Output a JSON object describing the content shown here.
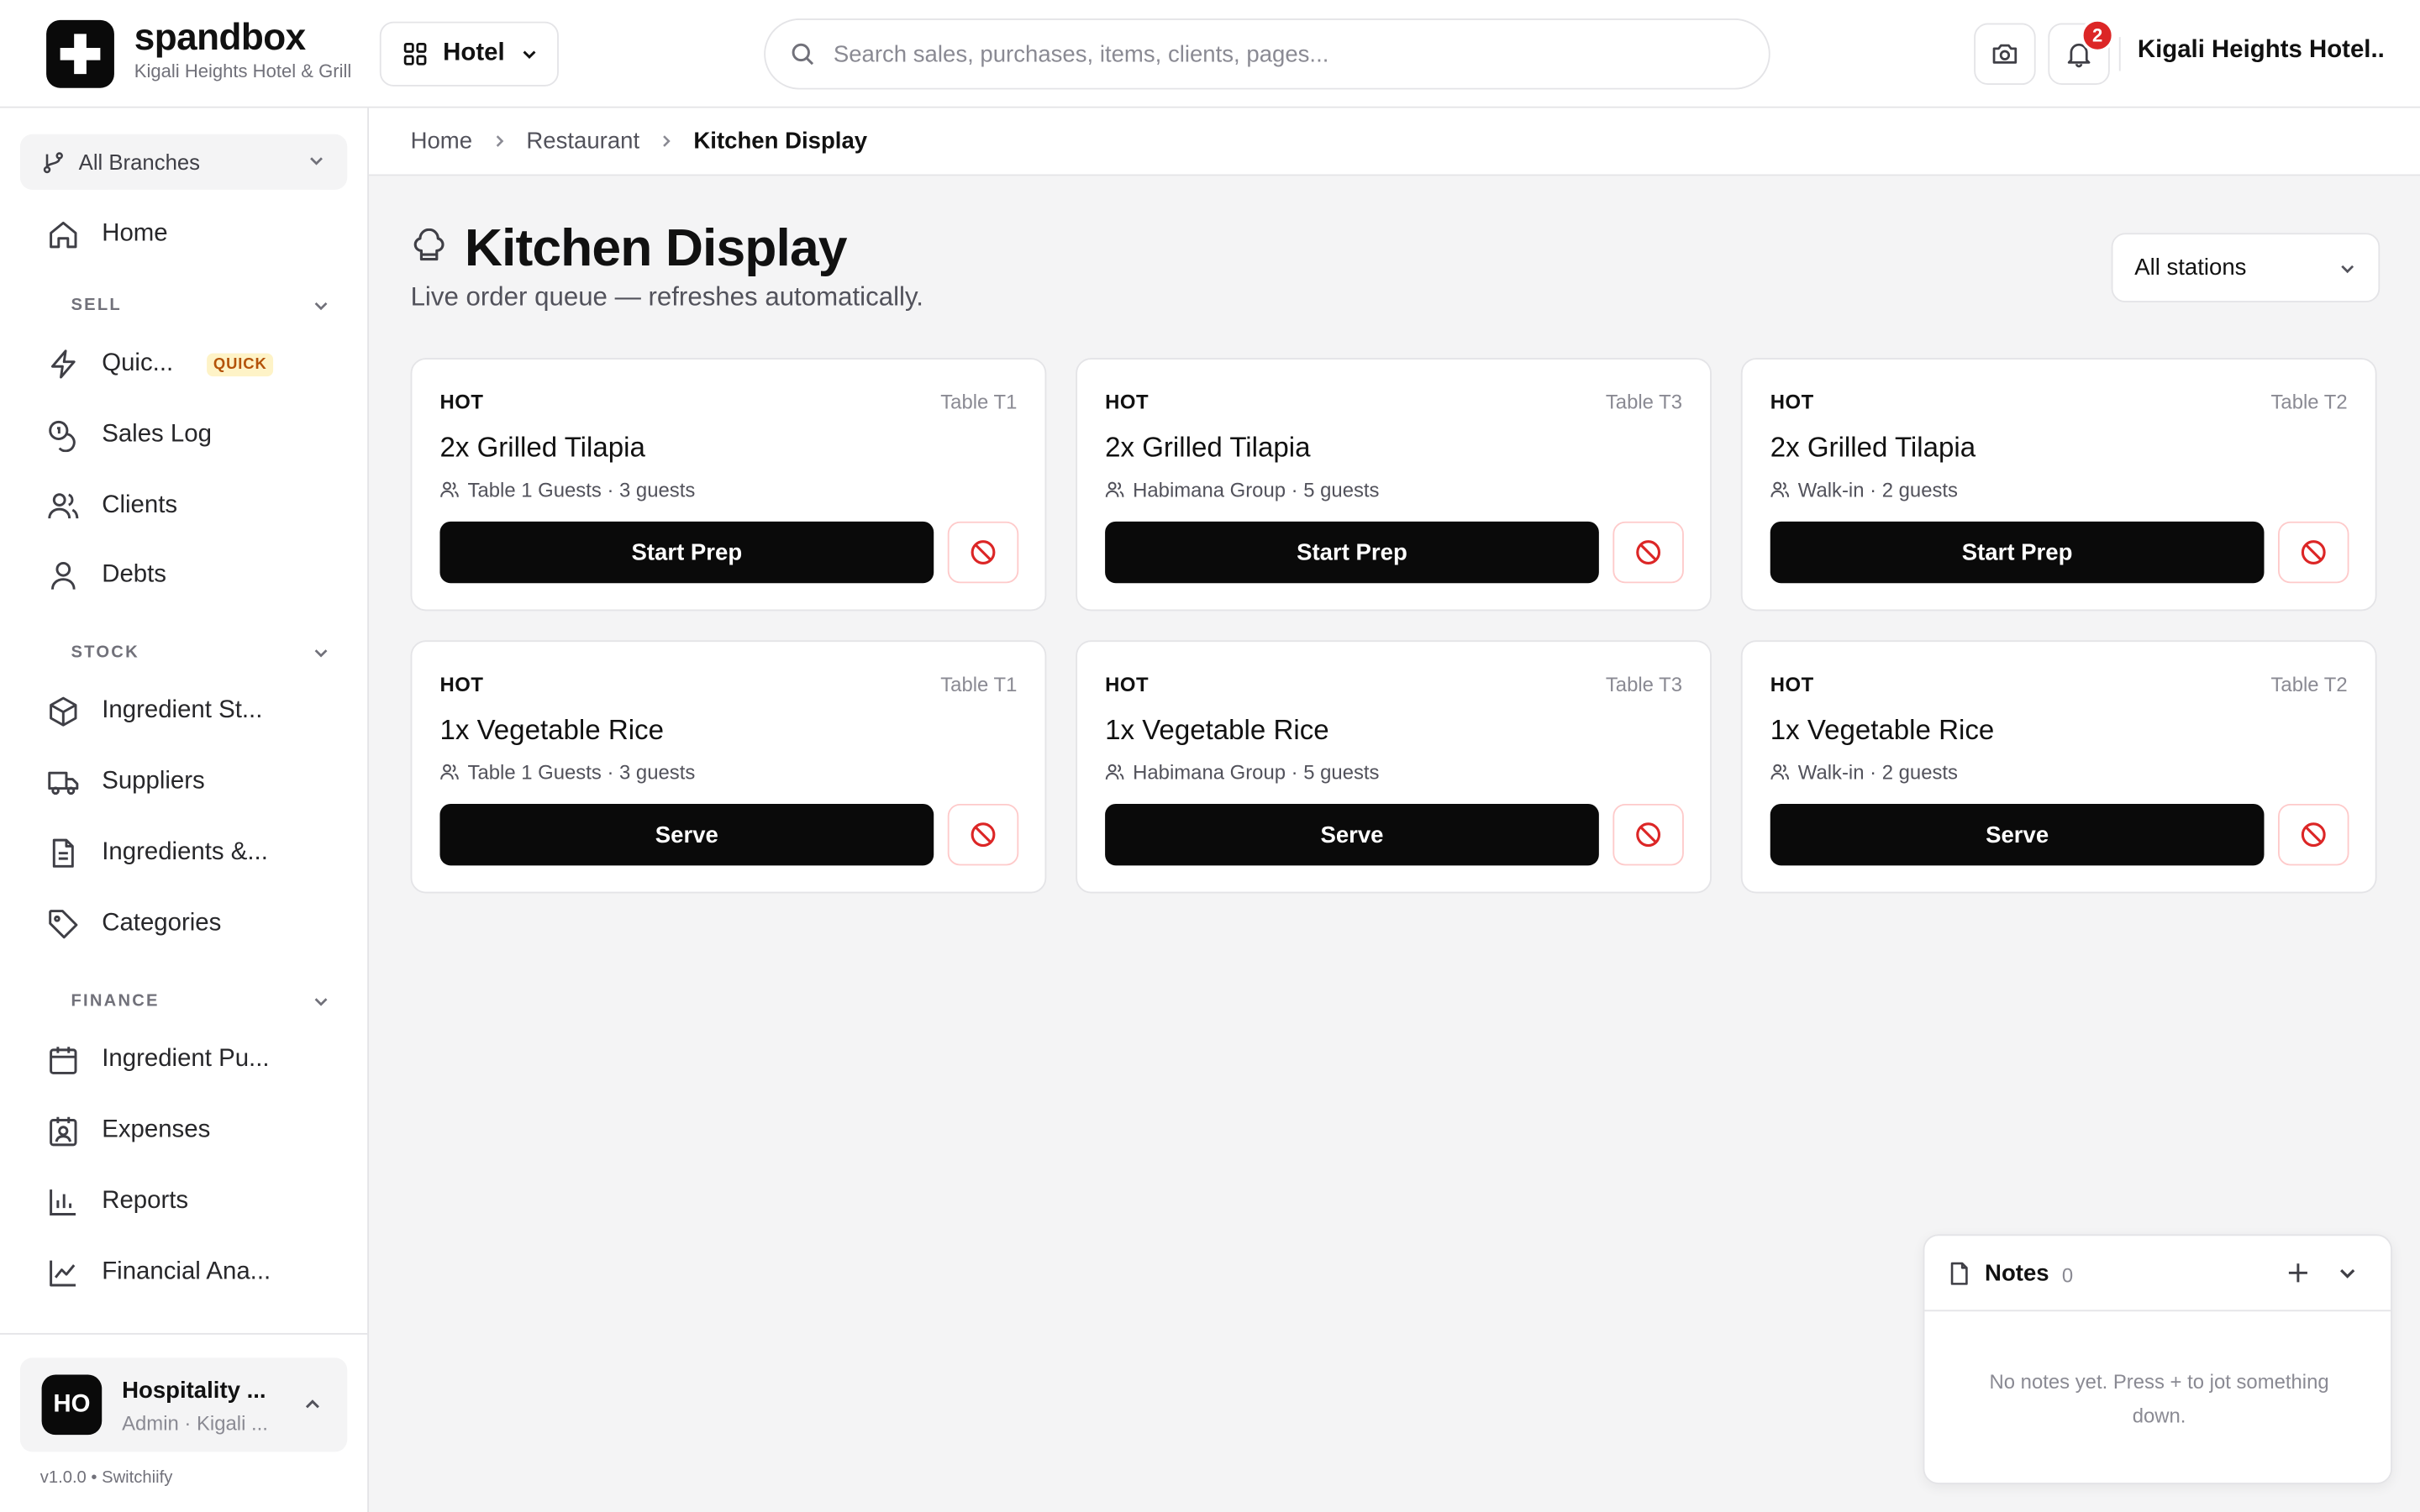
{
  "header": {
    "brand": "spandbox",
    "brand_sub": "Kigali Heights Hotel & Grill",
    "module": "Hotel",
    "search_placeholder": "Search sales, purchases, items, clients, pages...",
    "notif_count": "2",
    "hotel": "Kigali Heights Hotel..."
  },
  "sidebar": {
    "branch": "All Branches",
    "home": "Home",
    "sections": {
      "sell": "SELL",
      "stock": "STOCK",
      "finance": "FINANCE"
    },
    "sell_items": [
      "Quic...",
      "Sales Log",
      "Clients",
      "Debts"
    ],
    "quick_tag": "QUICK",
    "stock_items": [
      "Ingredient St...",
      "Suppliers",
      "Ingredients &...",
      "Categories"
    ],
    "finance_items": [
      "Ingredient Pu...",
      "Expenses",
      "Reports",
      "Financial Ana..."
    ],
    "user": {
      "initials": "HO",
      "name": "Hospitality ...",
      "role": "Admin · Kigali ..."
    },
    "version": "v1.0.0 • Switchiify"
  },
  "breadcrumb": [
    "Home",
    "Restaurant",
    "Kitchen Display"
  ],
  "page": {
    "title": "Kitchen Display",
    "subtitle": "Live order queue — refreshes automatically.",
    "station_filter": "All stations"
  },
  "orders": [
    {
      "station": "HOT",
      "table": "Table T1",
      "item": "2x Grilled Tilapia",
      "guests": "Table 1 Guests · 3 guests",
      "action": "Start Prep"
    },
    {
      "station": "HOT",
      "table": "Table T3",
      "item": "2x Grilled Tilapia",
      "guests": "Habimana Group · 5 guests",
      "action": "Start Prep"
    },
    {
      "station": "HOT",
      "table": "Table T2",
      "item": "2x Grilled Tilapia",
      "guests": "Walk-in · 2 guests",
      "action": "Start Prep"
    },
    {
      "station": "HOT",
      "table": "Table T1",
      "item": "1x Vegetable Rice",
      "guests": "Table 1 Guests · 3 guests",
      "action": "Serve"
    },
    {
      "station": "HOT",
      "table": "Table T3",
      "item": "1x Vegetable Rice",
      "guests": "Habimana Group · 5 guests",
      "action": "Serve"
    },
    {
      "station": "HOT",
      "table": "Table T2",
      "item": "1x Vegetable Rice",
      "guests": "Walk-in · 2 guests",
      "action": "Serve"
    }
  ],
  "notes": {
    "title": "Notes",
    "count": "0",
    "empty": "No notes yet. Press + to jot something down."
  },
  "colors": {
    "accent": "#0a0a0a",
    "danger": "#dc2626",
    "quick_tag": "#b45309"
  }
}
